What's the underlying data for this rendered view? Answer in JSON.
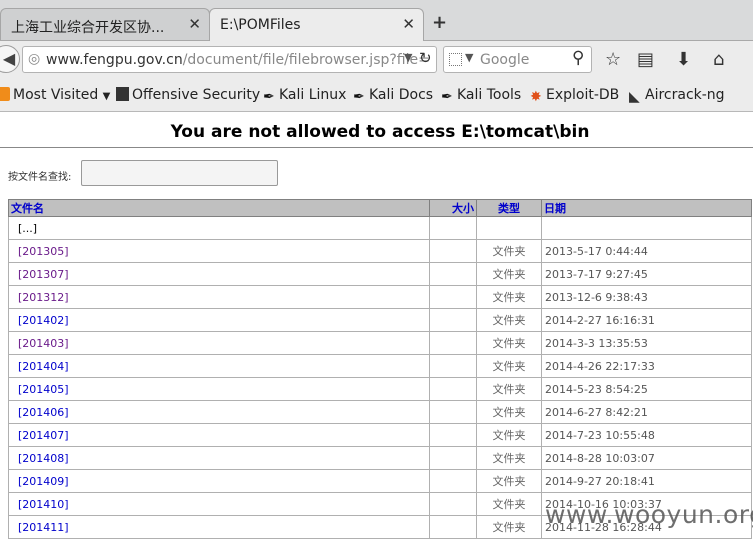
{
  "tabs": [
    {
      "label": "上海工业综合开发区协...",
      "active": false
    },
    {
      "label": "E:\\POMFiles",
      "active": true
    }
  ],
  "new_tab_label": "+",
  "url": {
    "host": "www.fengpu.gov.cn",
    "path": "/document/file/filebrowser.jsp?file="
  },
  "search": {
    "placeholder": "Google"
  },
  "bookmarks": [
    "Most Visited",
    "Offensive Security",
    "Kali Linux",
    "Kali Docs",
    "Kali Tools",
    "Exploit-DB",
    "Aircrack-ng"
  ],
  "page": {
    "heading": "You are not allowed to access E:\\tomcat\\bin",
    "filter_label": "按文件名查找:",
    "columns": {
      "name": "文件名",
      "size": "大小",
      "type": "类型",
      "date": "日期"
    },
    "parent": "[...]",
    "rows": [
      {
        "name": "[201305]",
        "type": "文件夹",
        "date": "2013-5-17 0:44:44",
        "visited": true
      },
      {
        "name": "[201307]",
        "type": "文件夹",
        "date": "2013-7-17 9:27:45",
        "visited": true
      },
      {
        "name": "[201312]",
        "type": "文件夹",
        "date": "2013-12-6 9:38:43",
        "visited": true
      },
      {
        "name": "[201402]",
        "type": "文件夹",
        "date": "2014-2-27 16:16:31",
        "visited": false
      },
      {
        "name": "[201403]",
        "type": "文件夹",
        "date": "2014-3-3 13:35:53",
        "visited": true
      },
      {
        "name": "[201404]",
        "type": "文件夹",
        "date": "2014-4-26 22:17:33",
        "visited": false
      },
      {
        "name": "[201405]",
        "type": "文件夹",
        "date": "2014-5-23 8:54:25",
        "visited": false
      },
      {
        "name": "[201406]",
        "type": "文件夹",
        "date": "2014-6-27 8:42:21",
        "visited": false
      },
      {
        "name": "[201407]",
        "type": "文件夹",
        "date": "2014-7-23 10:55:48",
        "visited": false
      },
      {
        "name": "[201408]",
        "type": "文件夹",
        "date": "2014-8-28 10:03:07",
        "visited": false
      },
      {
        "name": "[201409]",
        "type": "文件夹",
        "date": "2014-9-27 20:18:41",
        "visited": false
      },
      {
        "name": "[201410]",
        "type": "文件夹",
        "date": "2014-10-16 10:03:37",
        "visited": false
      },
      {
        "name": "[201411]",
        "type": "文件夹",
        "date": "2014-11-28 16:28:44",
        "visited": false
      }
    ]
  },
  "watermark": "www.wooyun.org",
  "colors": {
    "link": "#0000cc",
    "visited": "#6a1b8a",
    "header_bg": "#c0c0c0"
  }
}
